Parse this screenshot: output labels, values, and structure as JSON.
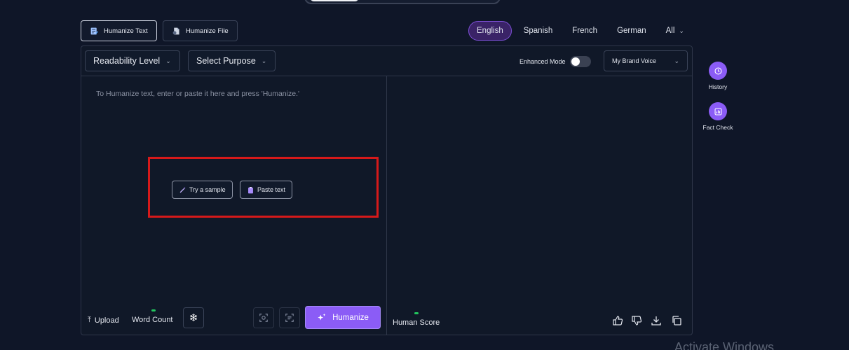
{
  "mode_tabs": [
    {
      "label": "Humanize Text",
      "icon": "document-pen-icon",
      "active": true
    },
    {
      "label": "Humanize File",
      "icon": "file-icon",
      "active": false
    }
  ],
  "languages": [
    {
      "label": "English",
      "active": true
    },
    {
      "label": "Spanish",
      "active": false
    },
    {
      "label": "French",
      "active": false
    },
    {
      "label": "German",
      "active": false
    },
    {
      "label": "All",
      "active": false,
      "dropdown": true
    }
  ],
  "toolbar": {
    "readability_label": "Readability Level",
    "purpose_label": "Select Purpose",
    "enhanced_mode_label": "Enhanced Mode",
    "enhanced_mode_on": false,
    "brand_voice_label": "My Brand Voice"
  },
  "editor": {
    "placeholder": "To Humanize text, enter or paste it here and press 'Humanize.'",
    "try_sample_label": "Try a sample",
    "paste_text_label": "Paste text"
  },
  "footer": {
    "upload_label": "Upload",
    "word_count_label": "Word Count",
    "humanize_label": "Humanize",
    "human_score_label": "Human Score"
  },
  "side_actions": [
    {
      "label": "History",
      "icon": "history-icon"
    },
    {
      "label": "Fact Check",
      "icon": "chart-icon"
    }
  ],
  "watermark": "Activate Windows",
  "colors": {
    "background": "#0f1628",
    "accent": "#8b5cf6",
    "active_lang_bg": "#3a2367",
    "highlight_border": "#d6191a",
    "status_green": "#22c55e"
  }
}
